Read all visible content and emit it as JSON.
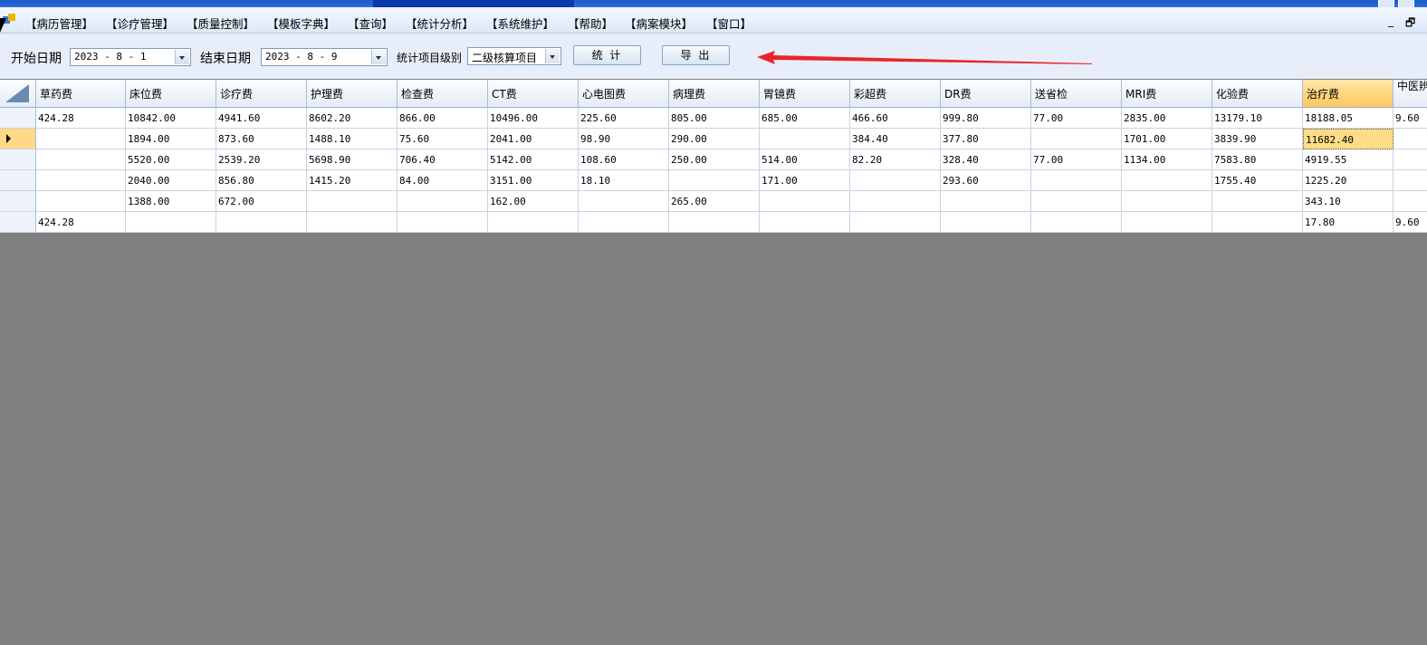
{
  "menu": {
    "items": [
      "【病历管理】",
      "【诊疗管理】",
      "【质量控制】",
      "【模板字典】",
      "【查询】",
      "【统计分析】",
      "【系统维护】",
      "【帮助】",
      "【病案模块】",
      "【窗口】"
    ],
    "minimize_glyph": "_",
    "restore_glyph": "🗗"
  },
  "toolbar": {
    "start_label": "开始日期",
    "start_value": "2023 - 8 - 1",
    "end_label": "结束日期",
    "end_value": "2023 - 8 - 9",
    "level_label": "统计项目级别",
    "level_value": "二级核算项目",
    "stat_button": "统 计",
    "export_button": "导 出"
  },
  "annotation": {
    "arrow_color": "#e8262a"
  },
  "grid": {
    "columns": [
      "草药费",
      "床位费",
      "诊疗费",
      "护理费",
      "检查费",
      "CT费",
      "心电图费",
      "病理费",
      "胃镜费",
      "彩超费",
      "DR费",
      "送省检",
      "MRI费",
      "化验费",
      "治疗费",
      "中医辨治"
    ],
    "selected_column": "治疗费",
    "current_row_index": 1,
    "rows": [
      [
        "424.28",
        "10842.00",
        "4941.60",
        "8602.20",
        "866.00",
        "10496.00",
        "225.60",
        "805.00",
        "685.00",
        "466.60",
        "999.80",
        "77.00",
        "2835.00",
        "13179.10",
        "18188.05",
        "9.60"
      ],
      [
        "",
        "1894.00",
        "873.60",
        "1488.10",
        "75.60",
        "2041.00",
        "98.90",
        "290.00",
        "",
        "384.40",
        "377.80",
        "",
        "1701.00",
        "3839.90",
        "11682.40",
        ""
      ],
      [
        "",
        "5520.00",
        "2539.20",
        "5698.90",
        "706.40",
        "5142.00",
        "108.60",
        "250.00",
        "514.00",
        "82.20",
        "328.40",
        "77.00",
        "1134.00",
        "7583.80",
        "4919.55",
        ""
      ],
      [
        "",
        "2040.00",
        "856.80",
        "1415.20",
        "84.00",
        "3151.00",
        "18.10",
        "",
        "171.00",
        "",
        "293.60",
        "",
        "",
        "1755.40",
        "1225.20",
        ""
      ],
      [
        "",
        "1388.00",
        "672.00",
        "",
        "",
        "162.00",
        "",
        "265.00",
        "",
        "",
        "",
        "",
        "",
        "",
        "343.10",
        ""
      ],
      [
        "424.28",
        "",
        "",
        "",
        "",
        "",
        "",
        "",
        "",
        "",
        "",
        "",
        "",
        "",
        "17.80",
        "9.60"
      ]
    ]
  }
}
